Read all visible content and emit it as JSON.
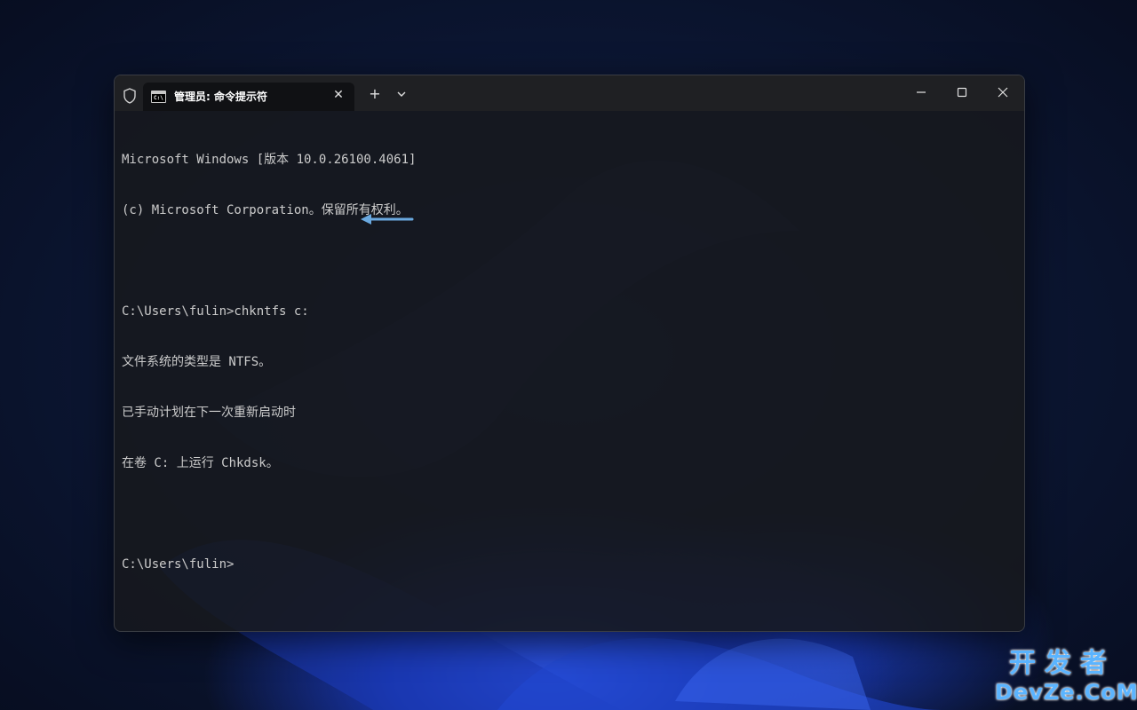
{
  "window": {
    "tab_title": "管理员: 命令提示符",
    "close_tab_glyph": "✕",
    "new_tab_glyph": "+"
  },
  "console": {
    "lines": [
      "Microsoft Windows [版本 10.0.26100.4061]",
      "(c) Microsoft Corporation。保留所有权利。",
      "",
      "C:\\Users\\fulin>chkntfs c:",
      "文件系统的类型是 NTFS。",
      "已手动计划在下一次重新启动时",
      "在卷 C: 上运行 Chkdsk。",
      "",
      "C:\\Users\\fulin>"
    ]
  },
  "watermark": {
    "line1": "开发者",
    "line2": "DevZe.CoM"
  },
  "colors": {
    "console_text": "#cccccc",
    "annotation_arrow": "#6aa9e0",
    "watermark": "#5bb4ff"
  },
  "icons": [
    "shield-icon",
    "cmd-icon",
    "close-icon",
    "plus-icon",
    "chevron-down-icon",
    "minimize-icon",
    "maximize-icon",
    "window-close-icon",
    "arrow-left-icon"
  ]
}
